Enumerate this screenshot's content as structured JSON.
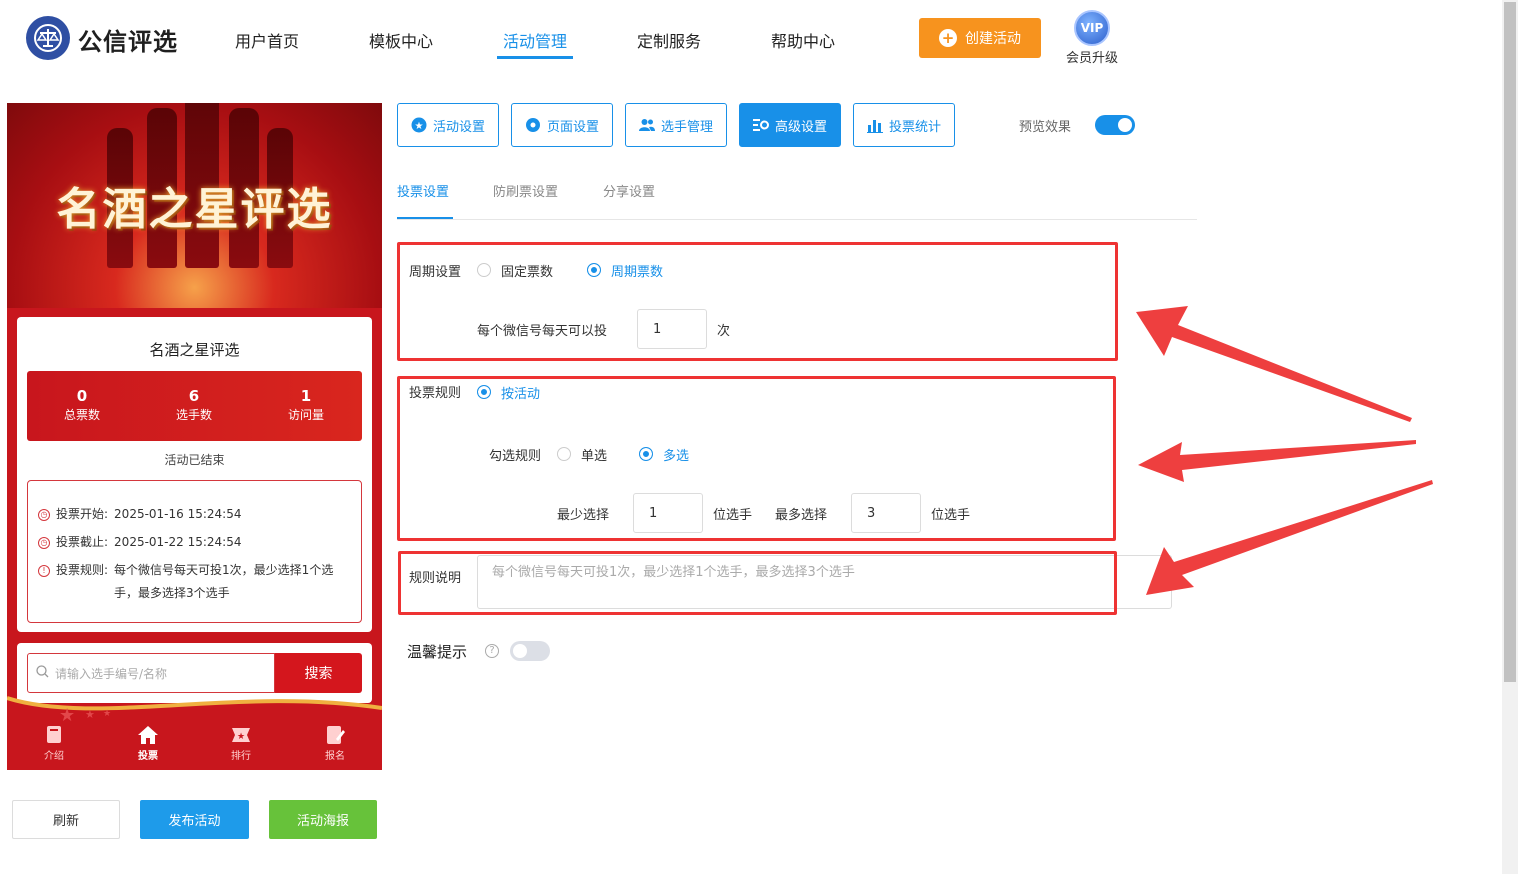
{
  "header": {
    "brand": "公信评选",
    "nav": [
      "用户首页",
      "模板中心",
      "活动管理",
      "定制服务",
      "帮助中心"
    ],
    "active_nav": "活动管理",
    "create_button": "创建活动",
    "vip_badge": "VIP",
    "vip_label": "会员升级"
  },
  "preview": {
    "banner_title": "名酒之星评选",
    "activity_name": "名酒之星评选",
    "stats": [
      {
        "value": "0",
        "label": "总票数"
      },
      {
        "value": "6",
        "label": "选手数"
      },
      {
        "value": "1",
        "label": "访问量"
      }
    ],
    "status": "活动已结束",
    "rules": [
      {
        "label": "投票开始:",
        "value": "2025-01-16 15:24:54"
      },
      {
        "label": "投票截止:",
        "value": "2025-01-22 15:24:54"
      },
      {
        "label": "投票规则:",
        "value": "每个微信号每天可投1次，最少选择1个选手，最多选择3个选手"
      }
    ],
    "search_placeholder": "请输入选手编号/名称",
    "search_button": "搜索",
    "tabs": [
      "介绍",
      "投票",
      "排行",
      "报名"
    ],
    "active_tab": "投票"
  },
  "actions": {
    "refresh": "刷新",
    "publish": "发布活动",
    "poster": "活动海报"
  },
  "toolbar": {
    "buttons": [
      "活动设置",
      "页面设置",
      "选手管理",
      "高级设置",
      "投票统计"
    ],
    "active": "高级设置",
    "preview_label": "预览效果",
    "preview_on": true
  },
  "subtabs": {
    "items": [
      "投票设置",
      "防刷票设置",
      "分享设置"
    ],
    "active": "投票设置"
  },
  "form": {
    "period": {
      "label": "周期设置",
      "options": [
        "固定票数",
        "周期票数"
      ],
      "selected": "周期票数",
      "per_day_label": "每个微信号每天可以投",
      "per_day_value": "1",
      "per_day_unit": "次"
    },
    "vote_rule": {
      "label": "投票规则",
      "option": "按活动",
      "check_rule_label": "勾选规则",
      "check_options": [
        "单选",
        "多选"
      ],
      "check_selected": "多选",
      "min_label": "最少选择",
      "min_value": "1",
      "min_unit": "位选手",
      "max_label": "最多选择",
      "max_value": "3",
      "max_unit": "位选手"
    },
    "description": {
      "label": "规则说明",
      "placeholder": "每个微信号每天可投1次，最少选择1个选手，最多选择3个选手"
    },
    "tip": {
      "label": "温馨提示",
      "help": "?",
      "enabled": false
    }
  },
  "colors": {
    "primary": "#1890e8",
    "orange": "#f7931e",
    "green": "#67c23a",
    "red": "#c8161d",
    "highlight": "#ee3333"
  }
}
